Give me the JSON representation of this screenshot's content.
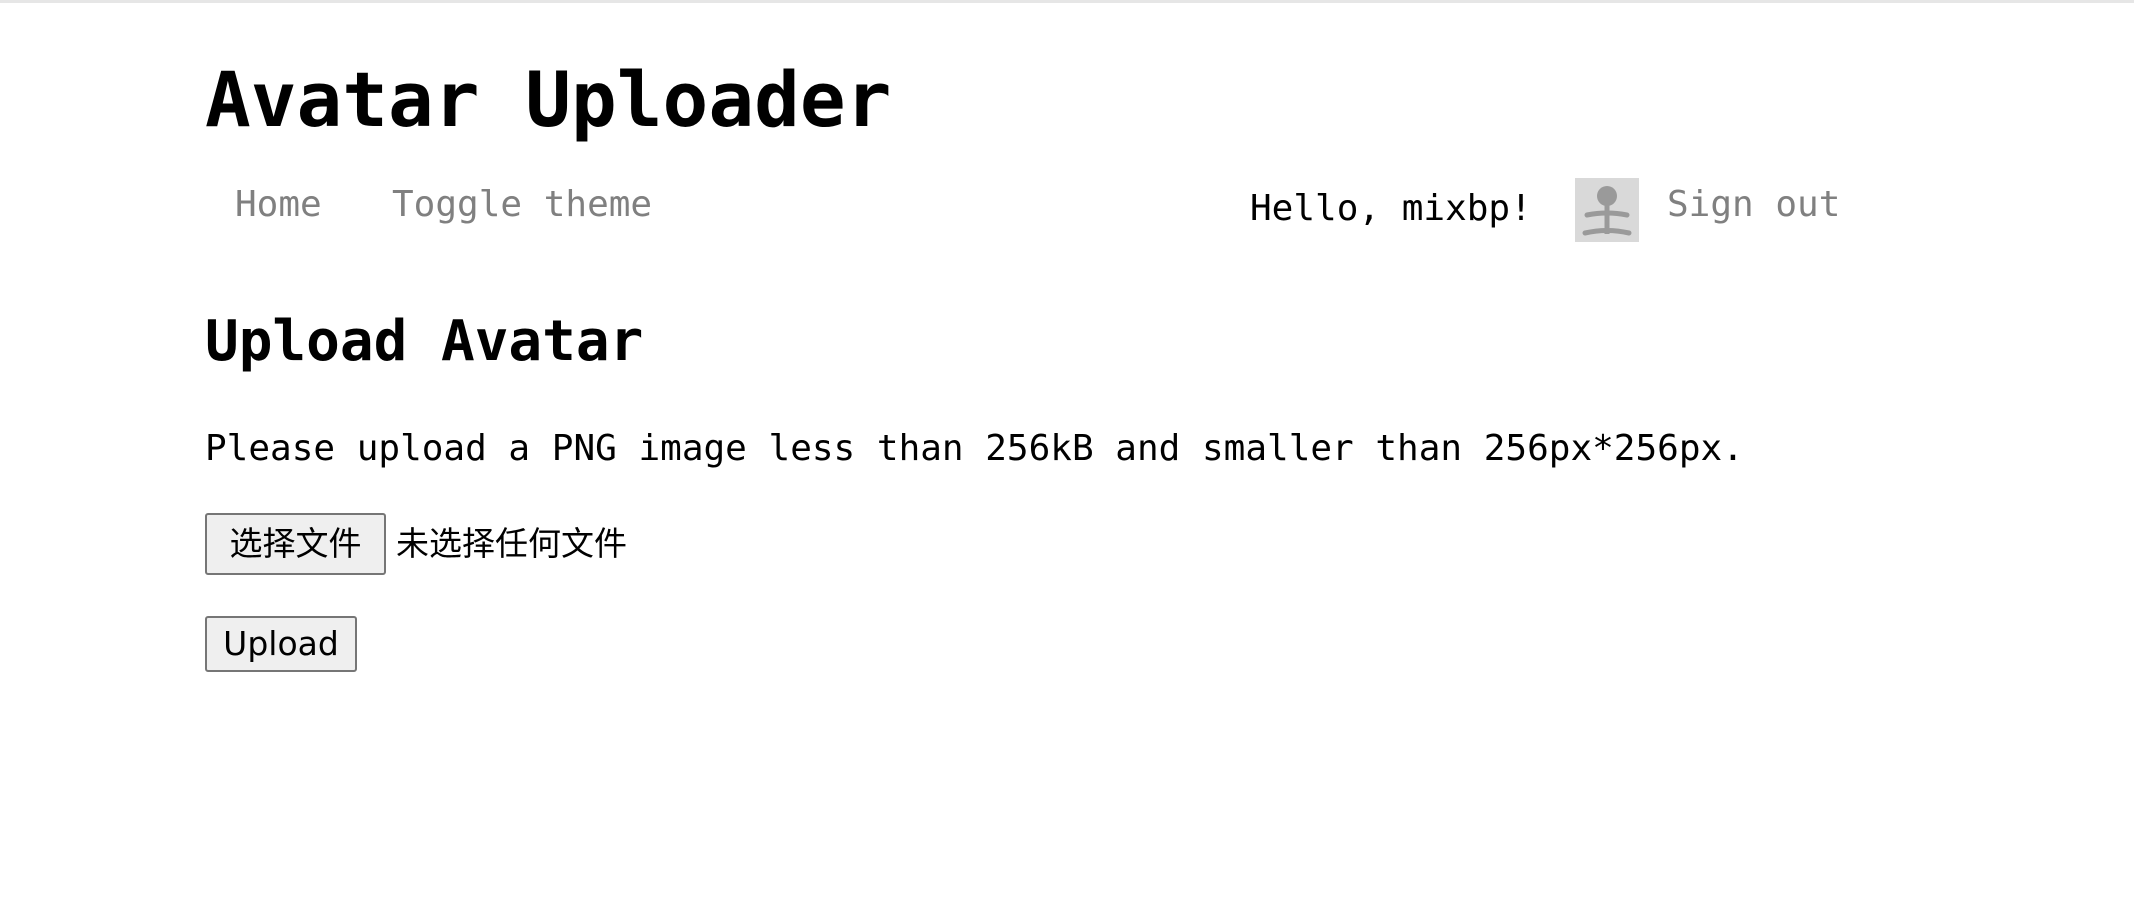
{
  "site": {
    "title": "Avatar Uploader"
  },
  "nav": {
    "home_label": "Home",
    "toggle_theme_label": "Toggle theme",
    "greeting": "Hello, mixbp!",
    "avatar_icon": "default-avatar-icon",
    "sign_out_label": "Sign out"
  },
  "main": {
    "heading": "Upload Avatar",
    "instructions": "Please upload a PNG image less than 256kB and smaller than 256px*256px.",
    "file_input": {
      "button_label": "选择文件",
      "status_text": "未选择任何文件"
    },
    "upload_label": "Upload"
  },
  "colors": {
    "nav_link": "#808080",
    "avatar_bg": "#d9d9d9",
    "avatar_fg": "#9a9a9a",
    "button_bg": "#efefef",
    "button_border": "#767676"
  }
}
